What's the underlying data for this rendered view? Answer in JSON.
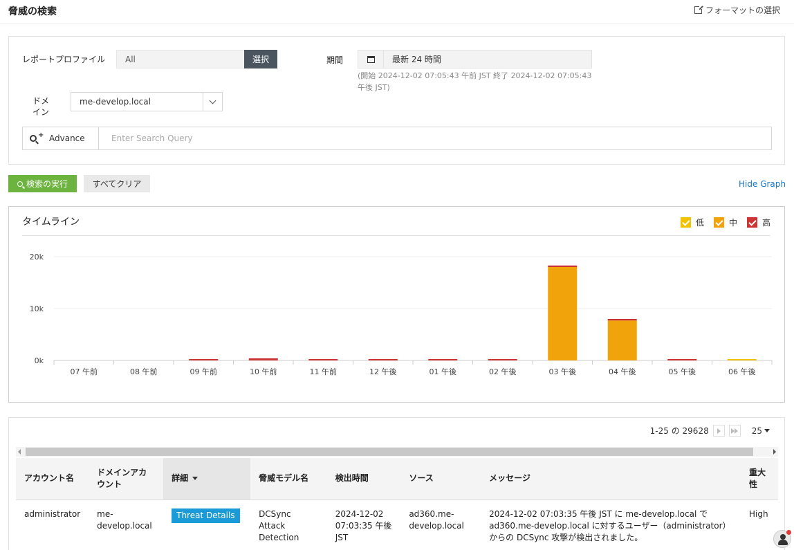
{
  "header": {
    "title": "脅威の検索",
    "format_link": "フォーマットの選択"
  },
  "filters": {
    "profile_label": "レポートプロファイル",
    "profile_value": "All",
    "select_button": "選択",
    "period_label": "期間",
    "period_value": "最新 24 時間",
    "period_range": "(開始 2024-12-02 07:05:43 午前 JST 終了 2024-12-02 07:05:43 午後 JST)",
    "domain_label_line1": "ドメ",
    "domain_label_line2": "イン",
    "domain_value": "me-develop.local",
    "advance_label": "Advance",
    "search_placeholder": "Enter Search Query"
  },
  "actions": {
    "run_search": "検索の実行",
    "clear_all": "すべてクリア",
    "hide_graph": "Hide Graph"
  },
  "timeline": {
    "title": "タイムライン",
    "legend": [
      {
        "name": "低",
        "color": "#f2c200"
      },
      {
        "name": "中",
        "color": "#f0a30a"
      },
      {
        "name": "高",
        "color": "#cc3333"
      }
    ]
  },
  "chart_data": {
    "type": "bar",
    "stacked": true,
    "categories": [
      "07 午前",
      "08 午前",
      "09 午前",
      "10 午前",
      "11 午前",
      "12 午後",
      "01 午後",
      "02 午後",
      "03 午後",
      "04 午後",
      "05 午後",
      "06 午後"
    ],
    "series": [
      {
        "name": "低",
        "color": "#f2c200",
        "values": [
          0,
          0,
          0,
          0,
          0,
          0,
          0,
          0,
          0,
          0,
          0,
          150
        ]
      },
      {
        "name": "中",
        "color": "#f0a30a",
        "values": [
          0,
          0,
          0,
          0,
          0,
          0,
          0,
          0,
          18000,
          7700,
          0,
          0
        ]
      },
      {
        "name": "高",
        "color": "#cc3333",
        "values": [
          0,
          0,
          150,
          400,
          150,
          250,
          150,
          150,
          300,
          300,
          250,
          0
        ]
      }
    ],
    "yticks": [
      "0k",
      "10k",
      "20k"
    ],
    "ylim": [
      0,
      20000
    ],
    "grid": true,
    "legend_position": "top-right"
  },
  "pagination": {
    "range_text": "1-25 の 29628",
    "per_page": "25"
  },
  "table": {
    "columns": [
      "アカウント名",
      "ドメインアカウント",
      "詳細",
      "脅威モデル名",
      "検出時間",
      "ソース",
      "メッセージ",
      "重大性"
    ],
    "rows": [
      {
        "account": "administrator",
        "domain_account": "me-develop.local",
        "details": "Threat Details",
        "threat_model": "DCSync Attack Detection",
        "time": "2024-12-02 07:03:35 午後 JST",
        "source": "ad360.me-develop.local",
        "message": "2024-12-02 07:03:35 午後 JST に me-develop.local で ad360.me-develop.local に対するユーザー（administrator）からの DCSync 攻撃が検出されました。",
        "severity": "High"
      }
    ]
  }
}
